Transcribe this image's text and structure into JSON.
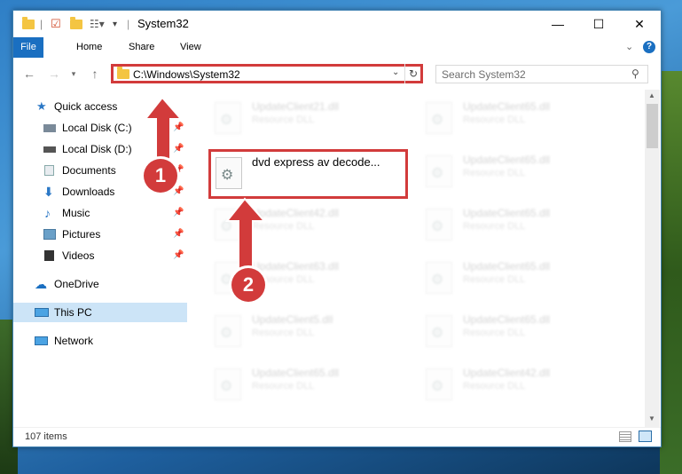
{
  "window": {
    "title": "System32"
  },
  "ribbon": {
    "tabs": [
      "File",
      "Home",
      "Share",
      "View"
    ]
  },
  "address": {
    "path": "C:\\Windows\\System32",
    "search_placeholder": "Search System32"
  },
  "sidebar": {
    "items": [
      {
        "label": "Quick access",
        "icon": "star-icon"
      },
      {
        "label": "Local Disk (C:)",
        "icon": "drive-icon"
      },
      {
        "label": "Local Disk (D:)",
        "icon": "drive-icon"
      },
      {
        "label": "Documents",
        "icon": "documents-icon"
      },
      {
        "label": "Downloads",
        "icon": "download-icon"
      },
      {
        "label": "Music",
        "icon": "music-icon"
      },
      {
        "label": "Pictures",
        "icon": "pictures-icon"
      },
      {
        "label": "Videos",
        "icon": "videos-icon"
      },
      {
        "label": "OneDrive",
        "icon": "cloud-icon"
      },
      {
        "label": "This PC",
        "icon": "computer-icon"
      },
      {
        "label": "Network",
        "icon": "network-icon"
      }
    ]
  },
  "files": {
    "highlighted": {
      "name": "dvd express av decode..."
    },
    "left_col": [
      {
        "name": "UpdateClient21.dll",
        "type": "Resource DLL"
      },
      {
        "name": "UpdateClient42.dll",
        "type": "Resource DLL"
      },
      {
        "name": "UpdateClient63.dll",
        "type": "Resource DLL"
      },
      {
        "name": "UpdateClient5.dll",
        "type": "Resource DLL"
      },
      {
        "name": "UpdateClient65.dll",
        "type": "Resource DLL"
      }
    ],
    "right_col": [
      {
        "name": "UpdateClient65.dll",
        "type": "Resource DLL"
      },
      {
        "name": "UpdateClient65.dll",
        "type": "Resource DLL"
      },
      {
        "name": "UpdateClient65.dll",
        "type": "Resource DLL"
      },
      {
        "name": "UpdateClient65.dll",
        "type": "Resource DLL"
      },
      {
        "name": "UpdateClient65.dll",
        "type": "Resource DLL"
      },
      {
        "name": "UpdateClient42.dll",
        "type": "Resource DLL"
      }
    ]
  },
  "status": {
    "items": "107 items"
  },
  "callouts": {
    "one": "1",
    "two": "2"
  },
  "colors": {
    "highlight": "#d23b3b",
    "file_tab": "#1a6fc1",
    "selected": "#cce4f7"
  }
}
